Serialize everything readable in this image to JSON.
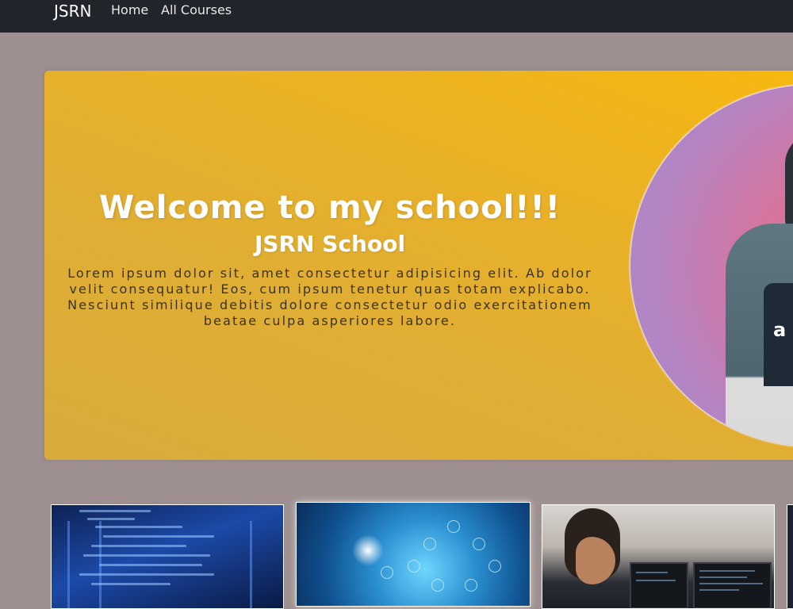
{
  "navbar": {
    "brand": "JSRN",
    "links": [
      {
        "label": "Home"
      },
      {
        "label": "All Courses"
      }
    ]
  },
  "hero": {
    "title": "Welcome to my school!!!",
    "subtitle": "JSRN School",
    "text": "Lorem ipsum dolor sit, amet consectetur adipisicing elit. Ab dolor velit consequatur! Eos, cum ipsum tenetur quas totam explicabo. Nesciunt similique debitis dolore consectetur odio exercitationem beatae culpa asperiores labore.",
    "gradient_colors": [
      "#f6b80f",
      "#d7ab3d"
    ],
    "portrait_logo": "a"
  },
  "courses": [
    {
      "image": "code-server-room-image"
    },
    {
      "image": "technology-network-image"
    },
    {
      "image": "students-computer-lab-image"
    },
    {
      "image": "course-image"
    }
  ],
  "colors": {
    "navbar_bg": "#21252b",
    "page_bg": "#9e9090",
    "hero_accent": "#f6b80f"
  }
}
